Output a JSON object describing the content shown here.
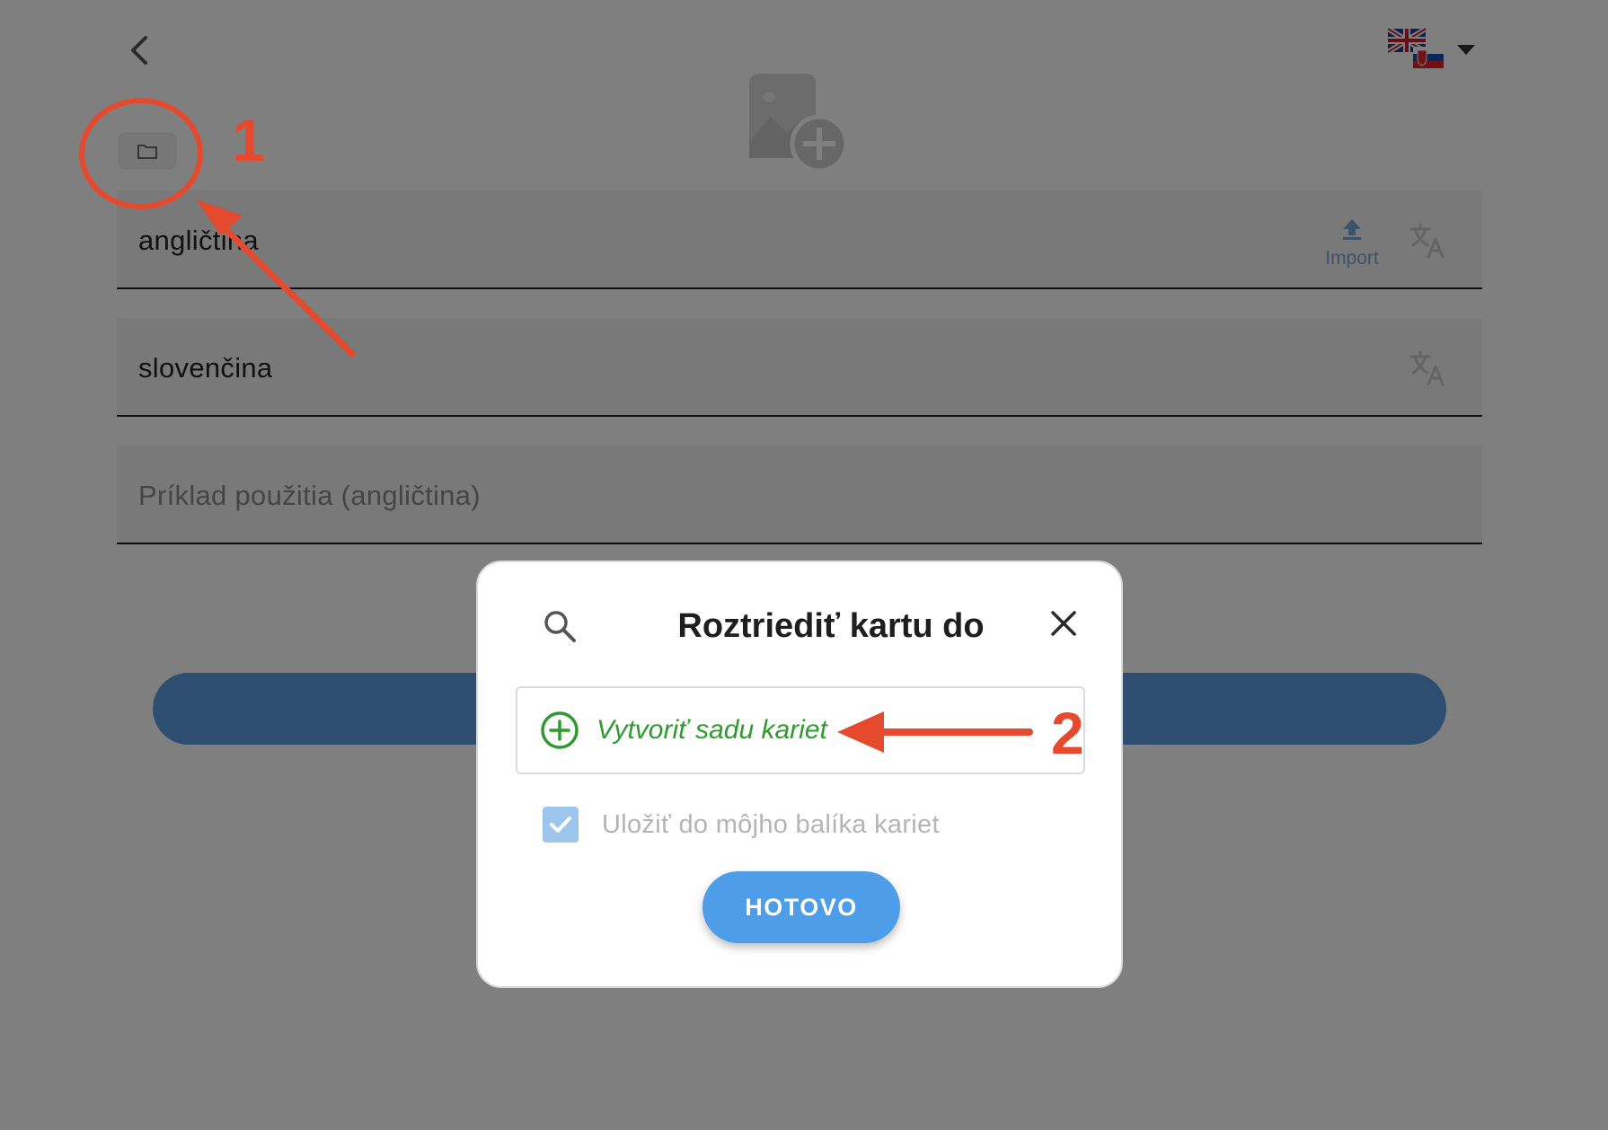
{
  "header": {
    "back_icon": "chevron-left-icon",
    "language_switch": {
      "icon": "flag-en-sk-icon",
      "caret": "caret-down-icon"
    },
    "image_placeholder_icon": "add-image-icon",
    "folder_icon": "folder-icon"
  },
  "fields": [
    {
      "label": "angličtina",
      "has_import": true,
      "translate_icon": "translate-icon"
    },
    {
      "label": "slovenčina",
      "has_import": false,
      "translate_icon": "translate-icon"
    },
    {
      "label": "Príklad použitia (angličtina)",
      "placeholder": true
    }
  ],
  "import": {
    "label": "Import",
    "icon": "upload-icon"
  },
  "dialog": {
    "title": "Roztriediť kartu do",
    "search_icon": "search-icon",
    "close_icon": "close-icon",
    "create_set_label": "Vytvoriť sadu kariet",
    "create_set_icon": "plus-circle-icon",
    "save_label": "Uložiť do môjho balíka kariet",
    "save_checked": true,
    "done_label": "HOTOVO"
  },
  "annotations": {
    "marker_1": "1",
    "marker_2": "2"
  },
  "colors": {
    "accent_blue": "#4d9de8",
    "create_green": "#2f9a2f",
    "annotation_red": "#e64a2e",
    "overlay": "rgba(0,0,0,0.5)"
  }
}
